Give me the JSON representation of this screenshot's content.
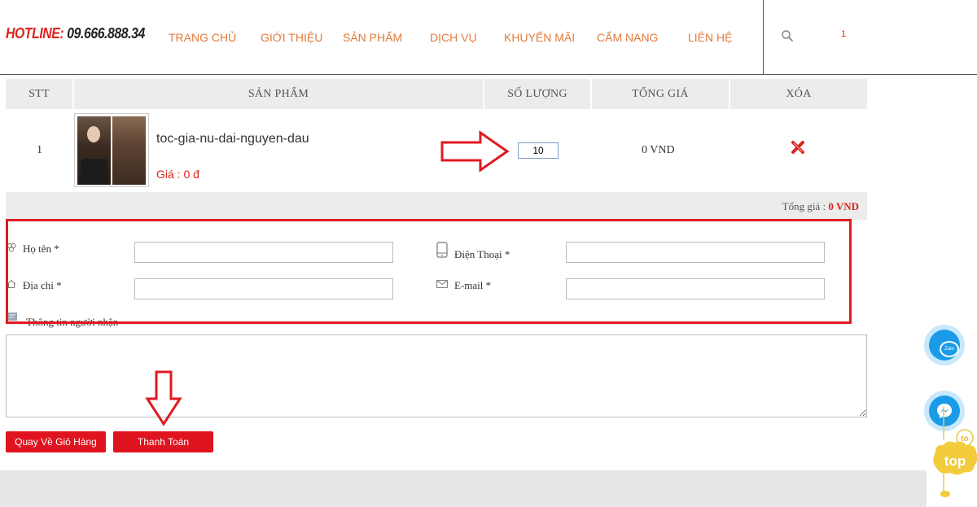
{
  "header": {
    "hotline_label": "HOTLINE:",
    "hotline_number": "09.666.888.34",
    "nav": [
      "TRANG CHỦ",
      "GIỚI THIỆU",
      "SẢN PHẨM",
      "DỊCH VỤ",
      "KHUYẾN MÃI",
      "CẨM NANG",
      "LIÊN HỆ"
    ],
    "cart_count": "1",
    "icons": {
      "search": "search-icon"
    }
  },
  "cart": {
    "columns": [
      "STT",
      "SẢN PHẨM",
      "SỐ LƯỢNG",
      "TỔNG GIÁ",
      "XÓA"
    ],
    "rows": [
      {
        "stt": "1",
        "name": "toc-gia-nu-dai-nguyen-dau",
        "price": "Giá : 0 đ",
        "quantity": "10",
        "total": "0  VND"
      }
    ],
    "total_label": "Tổng giá : ",
    "total_value": "0  VND"
  },
  "form": {
    "name_label": "Họ tên *",
    "phone_label": "Điện Thoại *",
    "address_label": "Địa chỉ *",
    "email_label": "E-mail *",
    "receiver_label": "Thông tin người nhận"
  },
  "buttons": {
    "back": "Quay Về Giỏ Hàng",
    "checkout": "Thanh Toán"
  },
  "floating": {
    "zalo": "Zalo",
    "top": "top",
    "to": "to"
  },
  "colors": {
    "accent": "#e0141e",
    "nav": "#e07a3a",
    "annotation": "#e01a22",
    "float": "#1a9be8"
  }
}
